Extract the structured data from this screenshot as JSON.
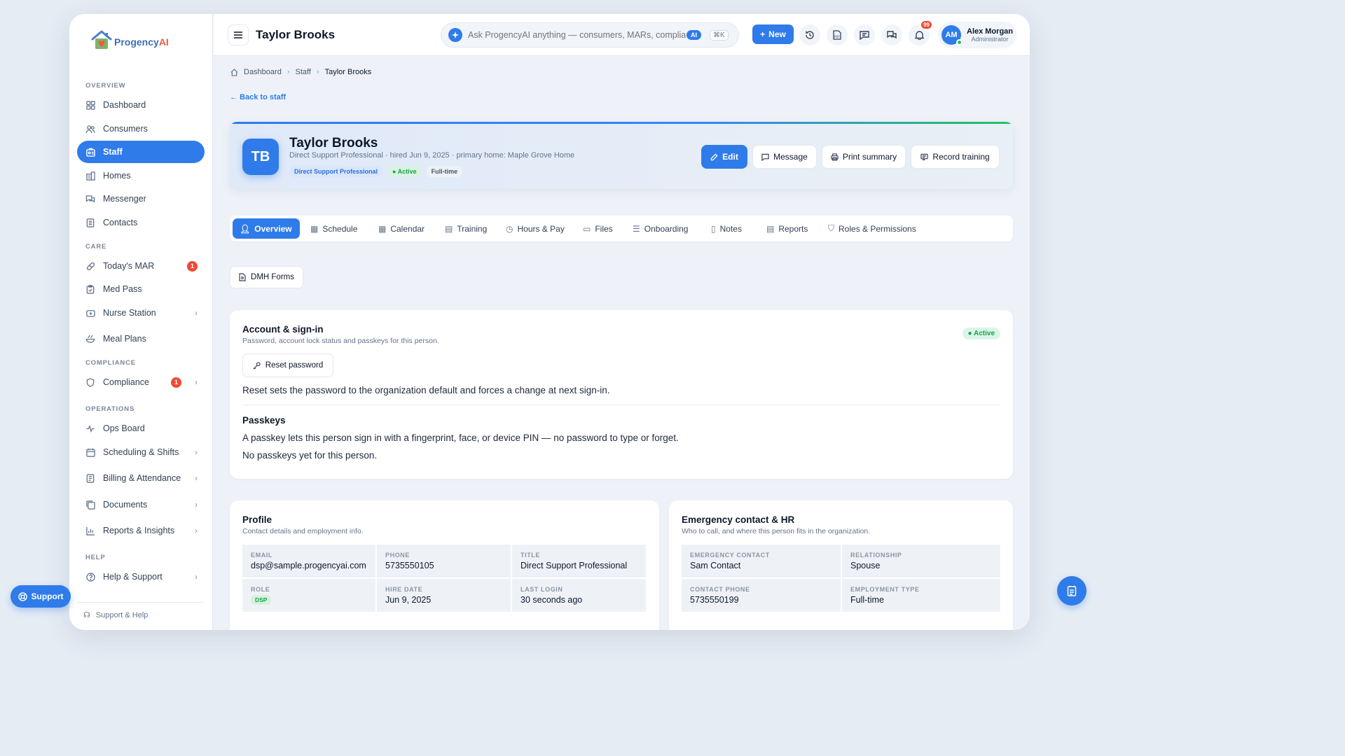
{
  "brand": {
    "name_a": "Progency",
    "name_b": "AI"
  },
  "sidebar": {
    "sections": {
      "overview": "OVERVIEW",
      "care": "CARE",
      "compliance": "COMPLIANCE",
      "operations": "OPERATIONS",
      "help": "HELP"
    },
    "items": [
      {
        "label": "Dashboard",
        "icon": "dashboard-icon"
      },
      {
        "label": "Consumers",
        "icon": "users-icon"
      },
      {
        "label": "Staff",
        "icon": "staff-icon",
        "active": true
      },
      {
        "label": "Homes",
        "icon": "homes-icon"
      },
      {
        "label": "Messenger",
        "icon": "messenger-icon"
      },
      {
        "label": "Contacts",
        "icon": "contacts-icon"
      },
      {
        "label": "Today's MAR",
        "icon": "pill-icon",
        "badge": "1"
      },
      {
        "label": "Med Pass",
        "icon": "clipboard-icon"
      },
      {
        "label": "Nurse Station",
        "icon": "nurse-icon"
      },
      {
        "label": "Meal Plans",
        "icon": "meal-icon"
      },
      {
        "label": "Compliance",
        "icon": "shield-icon",
        "badge": "1"
      },
      {
        "label": "Ops Board",
        "icon": "activity-icon"
      },
      {
        "label": "Scheduling & Shifts",
        "icon": "calendar-icon"
      },
      {
        "label": "Billing & Attendance",
        "icon": "billing-icon"
      },
      {
        "label": "Documents",
        "icon": "documents-icon"
      },
      {
        "label": "Reports & Insights",
        "icon": "chart-icon"
      },
      {
        "label": "Help & Support",
        "icon": "help-icon"
      }
    ],
    "footer": "Support & Help"
  },
  "topbar": {
    "title": "Taylor Brooks",
    "search_placeholder": "Ask ProgencyAI anything — consumers, MARs, compliance…",
    "ai_label": "AI",
    "shortcut": "⌘K",
    "new_label": "New",
    "notif_count": "99",
    "user": {
      "initials": "AM",
      "name": "Alex Morgan",
      "role": "Administrator"
    }
  },
  "breadcrumb": {
    "items": [
      "Dashboard",
      "Staff",
      "Taylor Brooks"
    ]
  },
  "back_label": "Back to staff",
  "hero": {
    "initials": "TB",
    "name": "Taylor Brooks",
    "subtitle": "Direct Support Professional · hired Jun 9, 2025 · primary home: Maple Grove Home",
    "tags": [
      "Direct Support Professional",
      "Active",
      "Full-time"
    ],
    "actions": {
      "edit": "Edit",
      "message": "Message",
      "print": "Print summary",
      "training": "Record training"
    }
  },
  "tabs": [
    "Overview",
    "Schedule",
    "Calendar",
    "Training",
    "Hours & Pay",
    "Files",
    "Onboarding",
    "Notes",
    "Reports",
    "Roles & Permissions"
  ],
  "dmh_label": "DMH Forms",
  "account": {
    "title": "Account & sign-in",
    "subtitle": "Password, account lock status and passkeys for this person.",
    "status": "Active",
    "reset_label": "Reset password",
    "reset_note": "Reset sets the password to the organization default and forces a change at next sign-in.",
    "passkeys_title": "Passkeys",
    "passkeys_note": "A passkey lets this person sign in with a fingerprint, face, or device PIN — no password to type or forget.",
    "passkeys_empty": "No passkeys yet for this person."
  },
  "profile": {
    "title": "Profile",
    "subtitle": "Contact details and employment info.",
    "fields": [
      {
        "k": "EMAIL",
        "v": "dsp@sample.progencyai.com"
      },
      {
        "k": "PHONE",
        "v": "5735550105"
      },
      {
        "k": "TITLE",
        "v": "Direct Support Professional"
      },
      {
        "k": "ROLE",
        "v": "DSP"
      },
      {
        "k": "HIRE DATE",
        "v": "Jun 9, 2025"
      },
      {
        "k": "LAST LOGIN",
        "v": "30 seconds ago"
      }
    ]
  },
  "emergency": {
    "title": "Emergency contact & HR",
    "subtitle": "Who to call, and where this person fits in the organization.",
    "fields": [
      {
        "k": "EMERGENCY CONTACT",
        "v": "Sam Contact"
      },
      {
        "k": "RELATIONSHIP",
        "v": "Spouse"
      },
      {
        "k": "CONTACT PHONE",
        "v": "5735550199"
      },
      {
        "k": "EMPLOYMENT TYPE",
        "v": "Full-time"
      }
    ]
  },
  "support_label": "Support",
  "colors": {
    "accent": "#2f7bea",
    "danger": "#ef4a35",
    "success": "#16a34a"
  }
}
